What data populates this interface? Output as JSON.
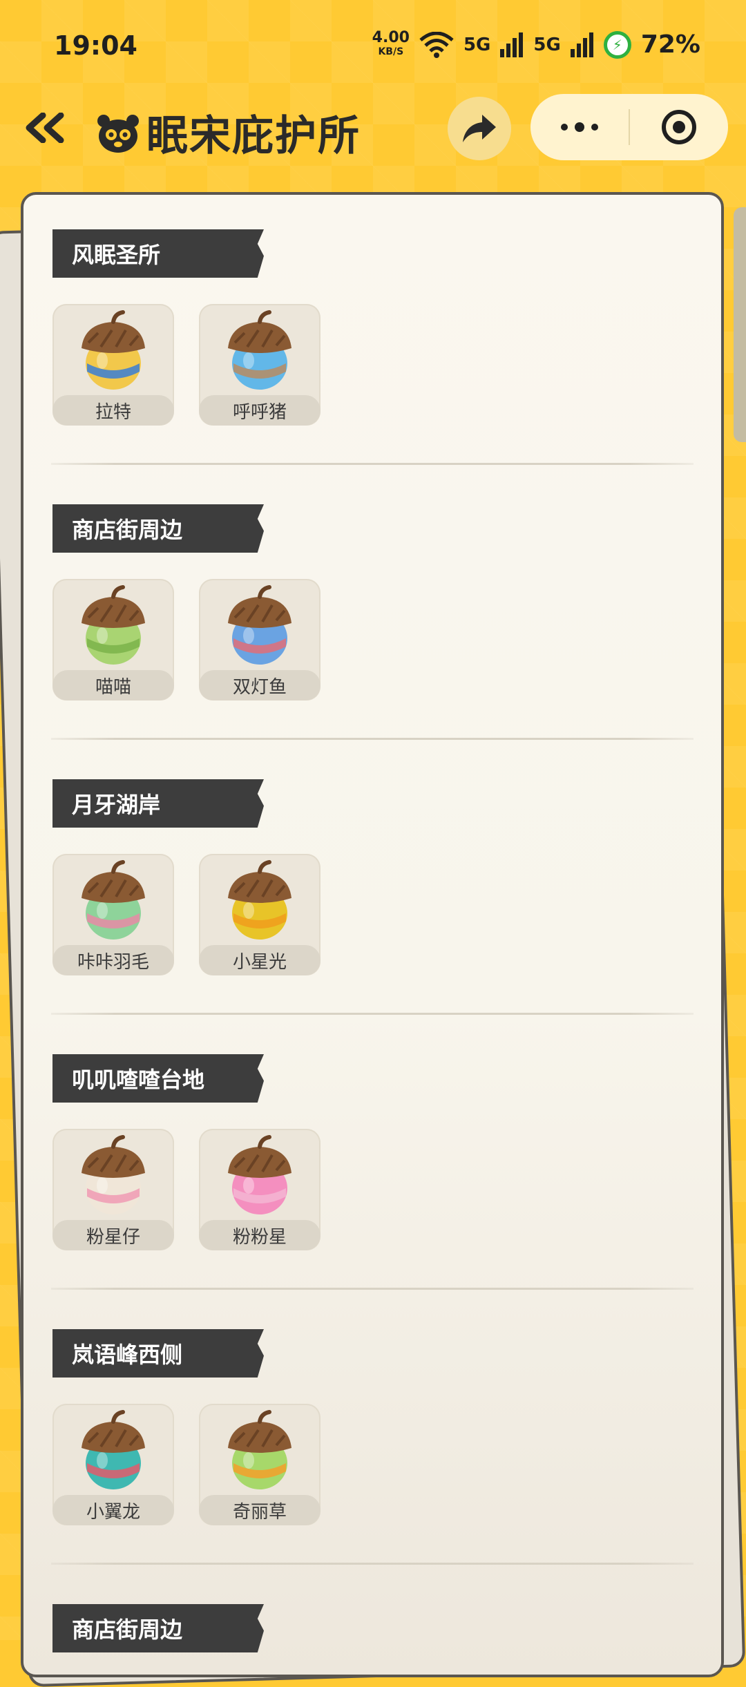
{
  "status_bar": {
    "time": "19:04",
    "net_speed_value": "4.00",
    "net_speed_unit": "KB/S",
    "signal_1": "5G",
    "signal_2": "5G",
    "battery": "72%"
  },
  "header": {
    "title": "眠宋庇护所"
  },
  "sections": [
    {
      "name": "风眠圣所",
      "items": [
        {
          "label": "拉特",
          "colors": [
            "#f2c84b",
            "#3a7ed6"
          ]
        },
        {
          "label": "呼呼猪",
          "colors": [
            "#62b7e8",
            "#b98c61"
          ]
        }
      ]
    },
    {
      "name": "商店街周边",
      "items": [
        {
          "label": "喵喵",
          "colors": [
            "#a9d472",
            "#7bb34a"
          ]
        },
        {
          "label": "双灯鱼",
          "colors": [
            "#6aa3e2",
            "#e06e78"
          ]
        }
      ]
    },
    {
      "name": "月牙湖岸",
      "items": [
        {
          "label": "咔咔羽毛",
          "colors": [
            "#8ed39a",
            "#e88aa6"
          ]
        },
        {
          "label": "小星光",
          "colors": [
            "#e8c428",
            "#f09d1c"
          ]
        }
      ]
    },
    {
      "name": "叽叽喳喳台地",
      "items": [
        {
          "label": "粉星仔",
          "colors": [
            "#f0e6d8",
            "#f09ab4"
          ]
        },
        {
          "label": "粉粉星",
          "colors": [
            "#f48fbf",
            "#f3b6d2"
          ]
        }
      ]
    },
    {
      "name": "岚语峰西侧",
      "items": [
        {
          "label": "小翼龙",
          "colors": [
            "#3fb8b1",
            "#e25a6c"
          ]
        },
        {
          "label": "奇丽草",
          "colors": [
            "#a7d86a",
            "#f3a02a"
          ]
        }
      ]
    },
    {
      "name": "商店街周边",
      "items": []
    }
  ]
}
